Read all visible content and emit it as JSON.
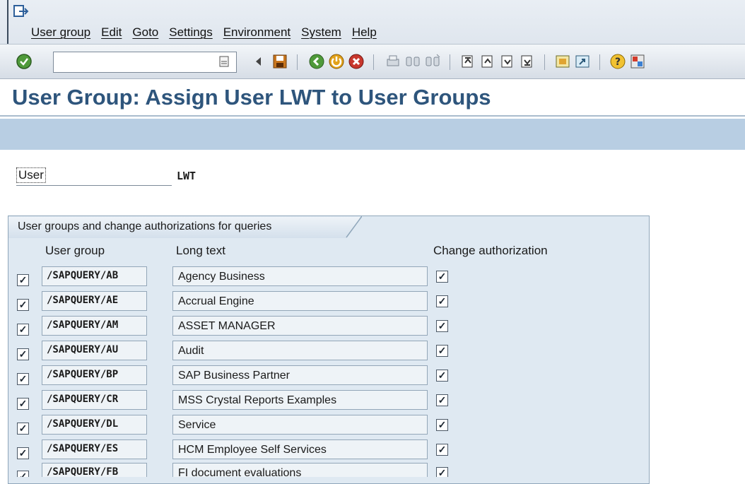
{
  "menubar": {
    "items": [
      "User group",
      "Edit",
      "Goto",
      "Settings",
      "Environment",
      "System",
      "Help"
    ]
  },
  "toolbar": {
    "command_value": "",
    "icons": [
      "enter-icon",
      "command-history-icon",
      "back-arrow-icon",
      "save-icon",
      "back-icon",
      "exit-icon",
      "cancel-icon",
      "print-icon",
      "find-icon",
      "find-next-icon",
      "first-page-icon",
      "previous-page-icon",
      "next-page-icon",
      "last-page-icon",
      "new-session-icon",
      "shortcut-icon",
      "help-icon",
      "customize-layout-icon"
    ]
  },
  "page": {
    "title": "User Group: Assign User LWT to User Groups"
  },
  "user": {
    "label": "User",
    "value": "LWT"
  },
  "groupbox": {
    "title": "User groups and change authorizations for queries",
    "columns": {
      "user_group": "User group",
      "long_text": "Long text",
      "change_authorization": "Change authorization"
    },
    "rows": [
      {
        "selected": true,
        "group": "/SAPQUERY/AB",
        "text": "Agency Business",
        "change": true
      },
      {
        "selected": true,
        "group": "/SAPQUERY/AE",
        "text": "Accrual Engine",
        "change": true
      },
      {
        "selected": true,
        "group": "/SAPQUERY/AM",
        "text": "ASSET MANAGER",
        "change": true
      },
      {
        "selected": true,
        "group": "/SAPQUERY/AU",
        "text": "Audit",
        "change": true
      },
      {
        "selected": true,
        "group": "/SAPQUERY/BP",
        "text": "SAP Business Partner",
        "change": true
      },
      {
        "selected": true,
        "group": "/SAPQUERY/CR",
        "text": "MSS Crystal Reports Examples",
        "change": true
      },
      {
        "selected": true,
        "group": "/SAPQUERY/DL",
        "text": "Service",
        "change": true
      },
      {
        "selected": true,
        "group": "/SAPQUERY/ES",
        "text": "HCM Employee Self Services",
        "change": true
      },
      {
        "selected": true,
        "group": "/SAPQUERY/FB",
        "text": "FI document evaluations",
        "change": true
      }
    ]
  },
  "colors": {
    "title": "#2e557c",
    "appbar": "#b8cee3",
    "groupbox_bg": "#dfe9f2"
  }
}
